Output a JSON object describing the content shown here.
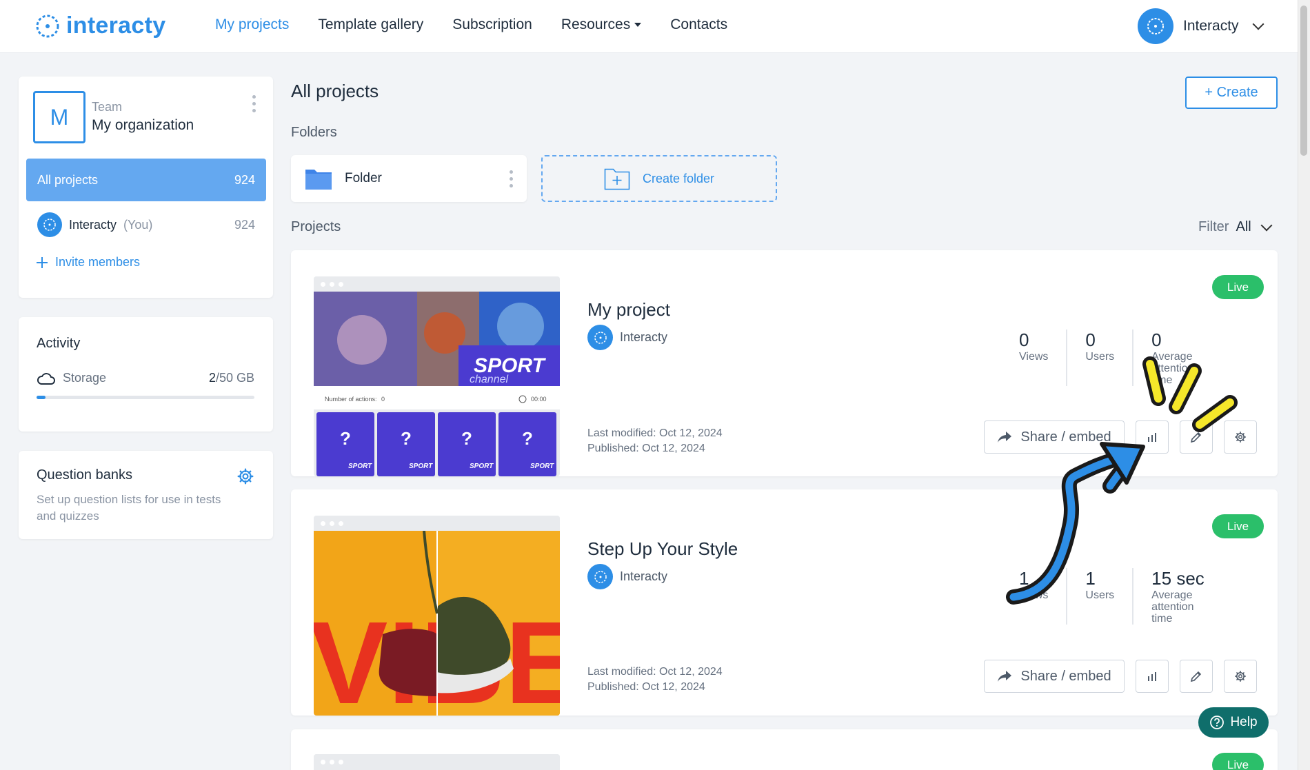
{
  "header": {
    "logo": "interacty",
    "nav": [
      {
        "label": "My projects",
        "active": true
      },
      {
        "label": "Template gallery",
        "active": false
      },
      {
        "label": "Subscription",
        "active": false
      },
      {
        "label": "Resources",
        "active": false
      },
      {
        "label": "Contacts",
        "active": false
      }
    ],
    "user_name": "Interacty"
  },
  "sidebar": {
    "team_initial": "M",
    "team_label": "Team",
    "team_name": "My organization",
    "all_projects": {
      "label": "All projects",
      "count": "924"
    },
    "member": {
      "name": "Interacty",
      "you": "(You)",
      "count": "924"
    },
    "invite_label": "Invite members",
    "activity": {
      "title": "Activity",
      "storage_label": "Storage",
      "storage_used": "2",
      "storage_total": "/50 GB",
      "storage_fraction": 0.04
    },
    "question_banks": {
      "title": "Question banks",
      "description": "Set up question lists for use in tests and quizzes"
    }
  },
  "main": {
    "title": "All projects",
    "create_label": "+ Create",
    "folders_label": "Folders",
    "folder_name": "Folder",
    "create_folder_label": "Create folder",
    "projects_label": "Projects",
    "filter_label": "Filter",
    "filter_value": "All"
  },
  "projects": [
    {
      "name": "My project",
      "owner": "Interacty",
      "status": "Live",
      "stats": [
        {
          "value": "0",
          "label": "Views"
        },
        {
          "value": "0",
          "label": "Users"
        },
        {
          "value": "0",
          "label": "Average attention time"
        }
      ],
      "last_modified": "Last modified: Oct 12, 2024",
      "published": "Published: Oct 12, 2024",
      "share_label": "Share / embed",
      "thumb_text": "SPORT",
      "thumb_subtext": "channel",
      "thumb_actions": "Number of actions:",
      "thumb_actions_value": "0",
      "thumb_timer": "00:00",
      "thumb_tile_mark": "?",
      "thumb_tile_label": "SPORT"
    },
    {
      "name": "Step Up Your Style",
      "owner": "Interacty",
      "status": "Live",
      "stats": [
        {
          "value": "1",
          "label": "Views"
        },
        {
          "value": "1",
          "label": "Users"
        },
        {
          "value": "15 sec",
          "label": "Average attention time"
        }
      ],
      "last_modified": "Last modified: Oct 12, 2024",
      "published": "Published: Oct 12, 2024",
      "share_label": "Share / embed",
      "thumb_text": "VIBE"
    },
    {
      "status": "Live"
    }
  ],
  "help_label": "Help",
  "colors": {
    "accent": "#2d8ee6",
    "live": "#2bbf6a",
    "help": "#0f6e6b",
    "annotation_arrow": "#2d8ee6",
    "annotation_marks": "#f5e72a"
  }
}
